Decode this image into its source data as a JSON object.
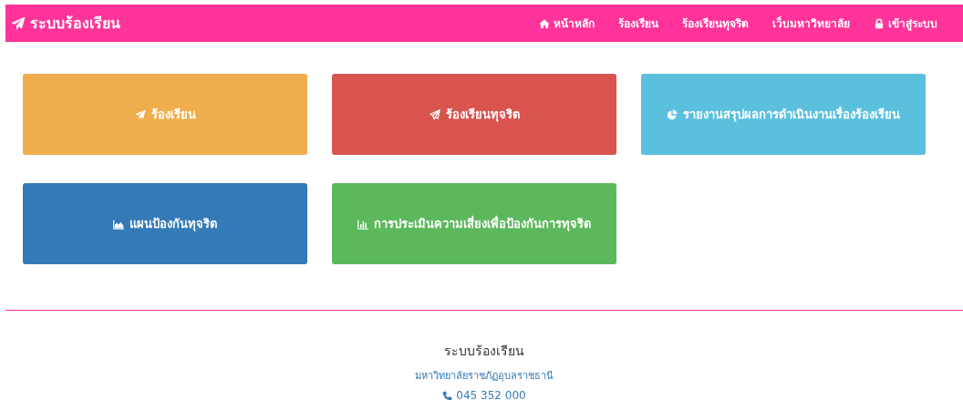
{
  "navbar": {
    "brand": "ระบบร้องเรียน",
    "items": [
      {
        "label": "หน้าหลัก",
        "kind": "home"
      },
      {
        "label": "ร้องเรียน",
        "kind": "plain"
      },
      {
        "label": "ร้องเรียนทุจริต",
        "kind": "plain"
      },
      {
        "label": "เว็บมหาวิทยาลัย",
        "kind": "plain"
      },
      {
        "label": "เข้าสู่ระบบ",
        "kind": "lock"
      }
    ]
  },
  "tiles": [
    {
      "label": "ร้องเรียน",
      "kind": "plane",
      "color": "#f0ad4e"
    },
    {
      "label": "ร้องเรียนทุจริต",
      "kind": "plane-outline",
      "color": "#d9534f"
    },
    {
      "label": "รายงานสรุปผลการดำเนินงานเรื่องร้องเรียน",
      "kind": "pie",
      "color": "#5bc0de"
    },
    {
      "label": "แผนป้องกันทุจริต",
      "kind": "area",
      "color": "#337ab7"
    },
    {
      "label": "การประเมินความเสี่ยงเพื่อป้องกันการทุจริต",
      "kind": "bar",
      "color": "#5cb85c"
    }
  ],
  "footer": {
    "title": "ระบบร้องเรียน",
    "organization": "มหาวิทยาลัยราชภัฏอุบลราชธานี",
    "phone": "045 352 000"
  }
}
